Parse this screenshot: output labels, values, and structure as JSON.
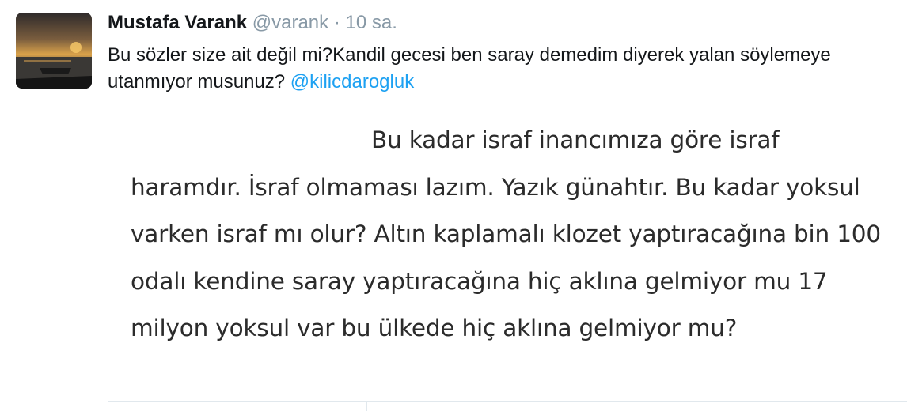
{
  "tweet": {
    "author_name": "Mustafa Varank",
    "author_handle": "@varank",
    "separator": "·",
    "timestamp": "10 sa.",
    "text": "Bu sözler size ait değil mi?Kandil gecesi ben saray demedim diyerek yalan söylemeye utanmıyor musunuz? ",
    "mention": "@kilicdarogluk"
  },
  "media": {
    "line1": "Bu kadar israf inancımıza göre israf",
    "rest": "haramdır. İsraf olmaması lazım. Yazık günahtır. Bu kadar yoksul varken israf mı olur? Altın kaplamalı klozet yaptıracağına bin 100 odalı kendine saray yaptıracağına hiç aklına gelmiyor mu 17 milyon yoksul var bu ülkede hiç aklına gelmiyor mu?"
  }
}
